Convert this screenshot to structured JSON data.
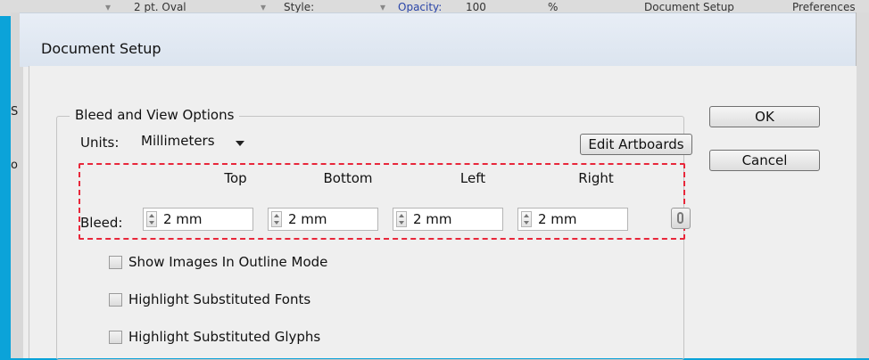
{
  "background_toolbar": {
    "stroke_label": "2 pt. Oval",
    "style_label": "Style:",
    "opacity_label": "Opacity:",
    "opacity_value": "100",
    "percent": "%",
    "document_setup_button": "Document Setup",
    "preferences_button": "Preferences"
  },
  "dialog": {
    "title": "Document Setup",
    "group_legend": "Bleed and View Options",
    "units_label": "Units:",
    "units_value": "Millimeters",
    "edit_artboards_label": "Edit Artboards",
    "ok_label": "OK",
    "cancel_label": "Cancel",
    "bleed_label": "Bleed:",
    "bleed_fields": [
      {
        "label": "Top",
        "value": "2 mm"
      },
      {
        "label": "Bottom",
        "value": "2 mm"
      },
      {
        "label": "Left",
        "value": "2 mm"
      },
      {
        "label": "Right",
        "value": "2 mm"
      }
    ],
    "checkboxes": [
      {
        "label": "Show Images In Outline Mode",
        "checked": false
      },
      {
        "label": "Highlight Substituted Fonts",
        "checked": false
      },
      {
        "label": "Highlight Substituted Glyphs",
        "checked": false
      }
    ]
  },
  "colors": {
    "frame": "#0ba3d9",
    "highlight": "#e8273a"
  }
}
